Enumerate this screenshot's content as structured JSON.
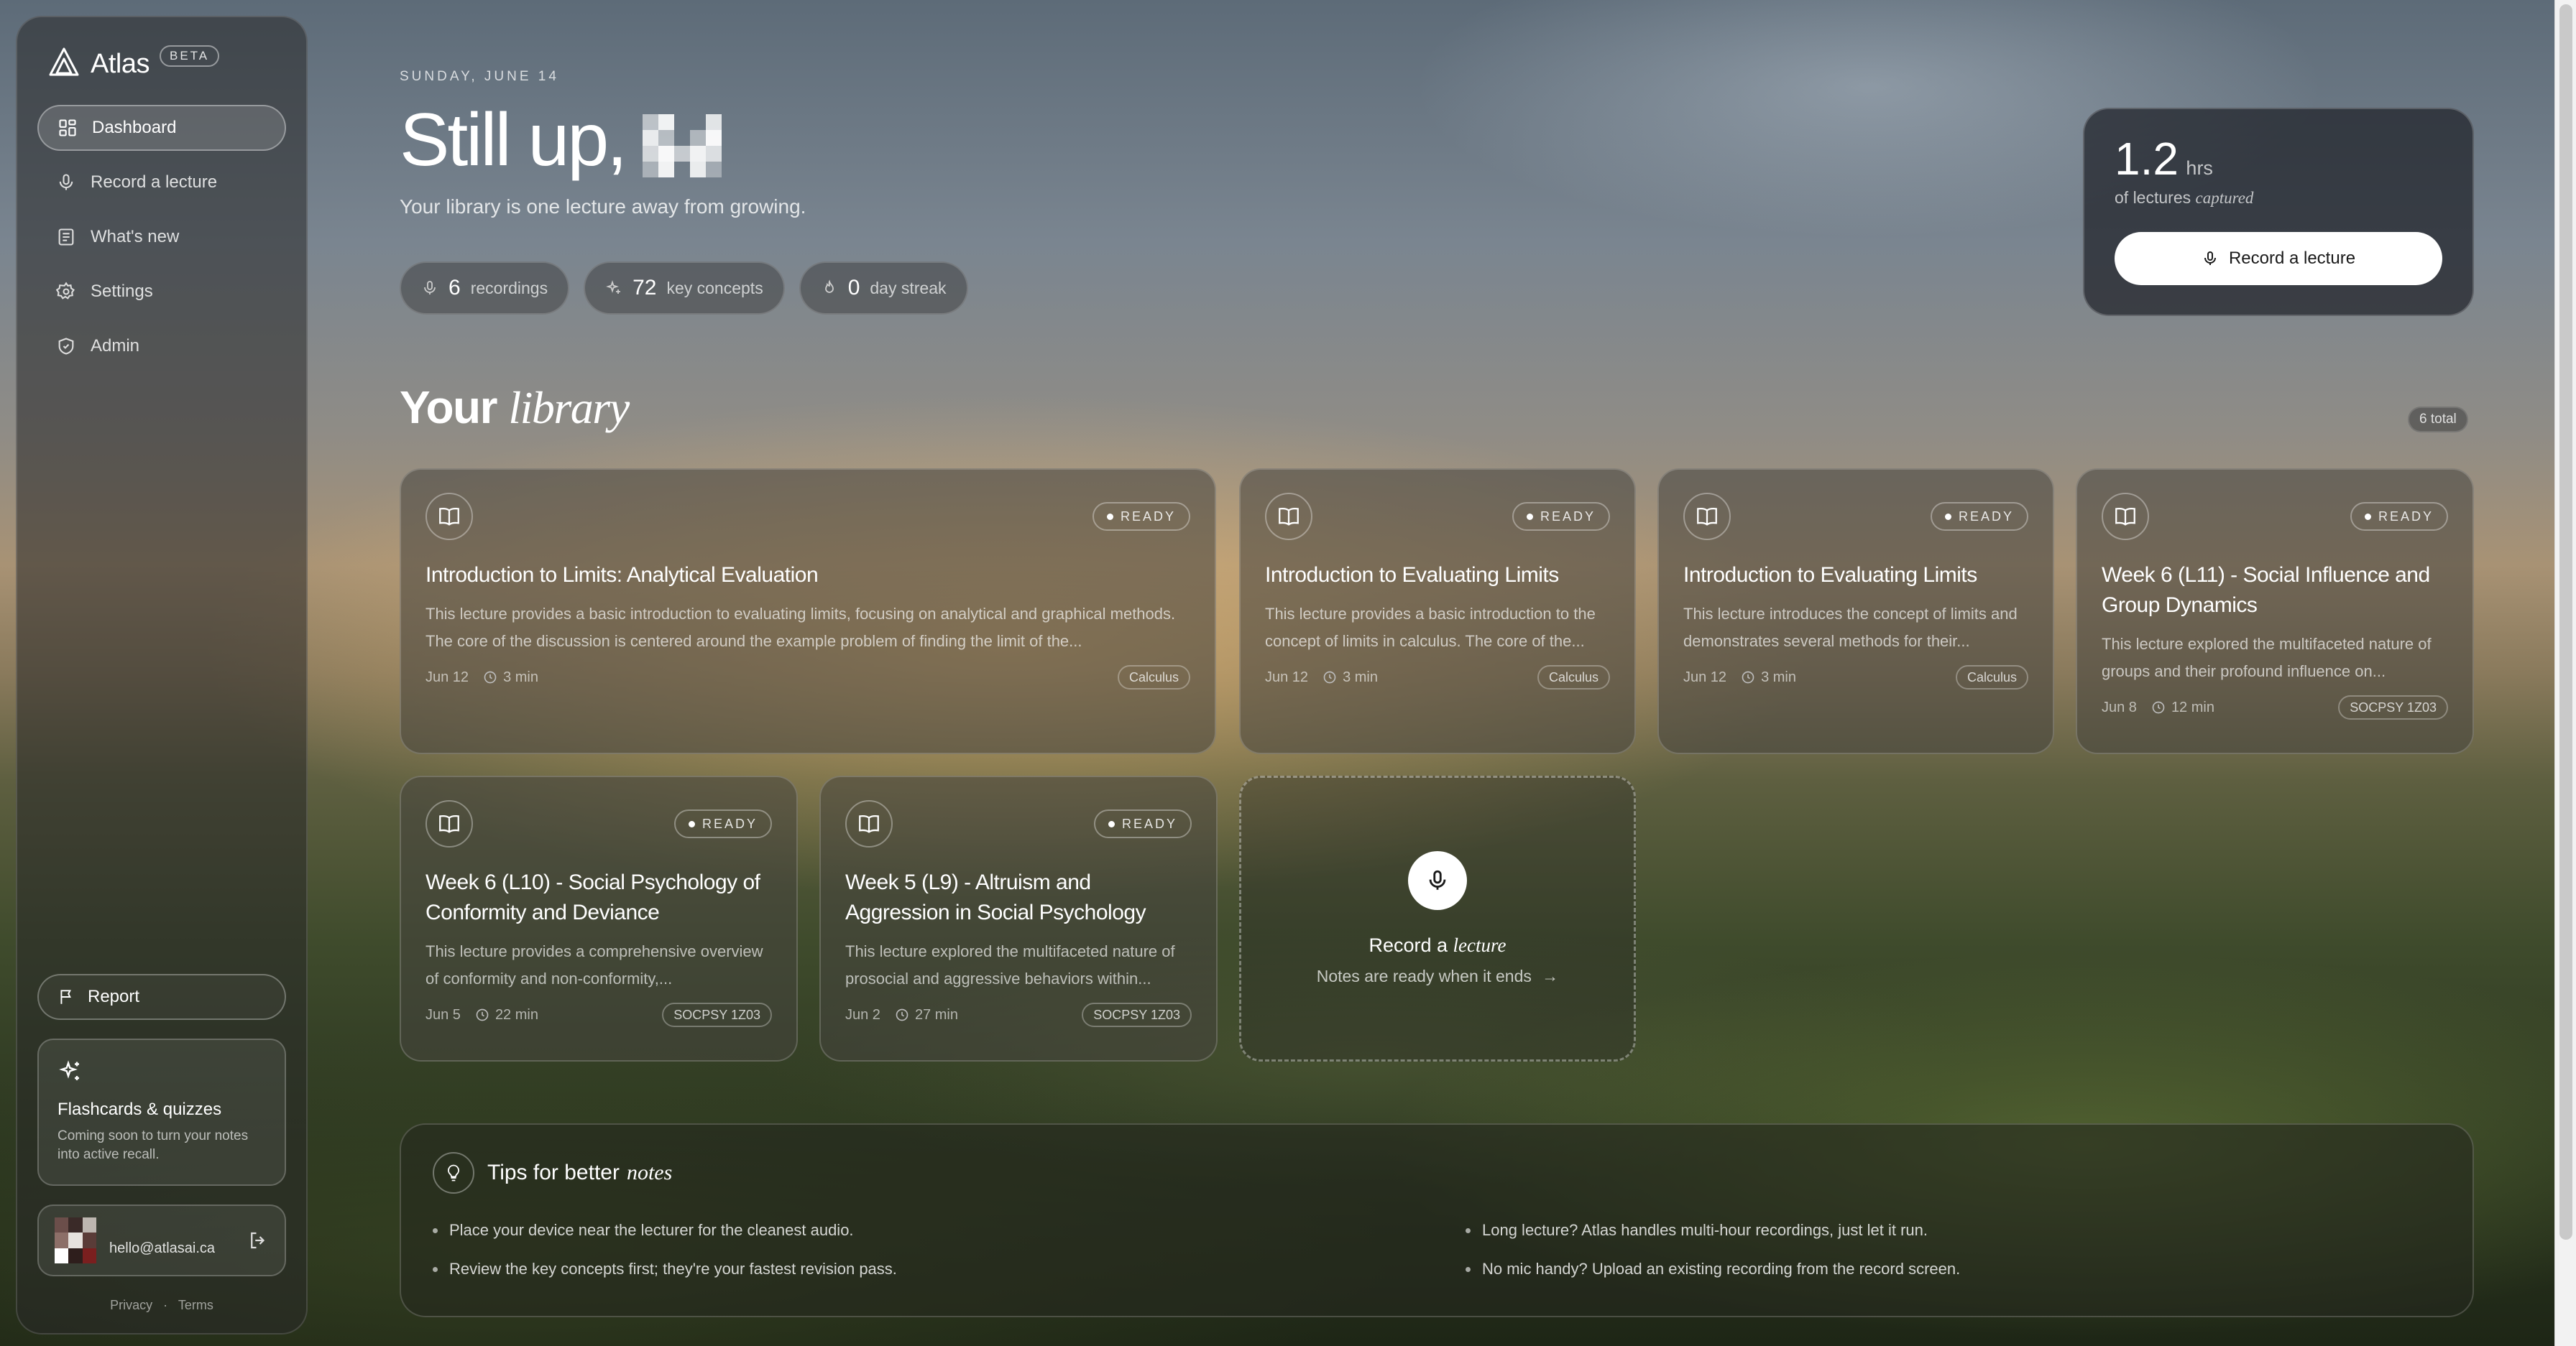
{
  "brand": {
    "name": "Atlas",
    "badge": "BETA"
  },
  "nav": [
    {
      "label": "Dashboard",
      "icon": "grid-icon",
      "active": true
    },
    {
      "label": "Record a lecture",
      "icon": "mic-icon"
    },
    {
      "label": "What's new",
      "icon": "news-icon"
    },
    {
      "label": "Settings",
      "icon": "gear-icon"
    },
    {
      "label": "Admin",
      "icon": "shield-icon"
    }
  ],
  "sidebar": {
    "report_label": "Report",
    "promo_title": "Flashcards & quizzes",
    "promo_text": "Coming soon to turn your notes into active recall.",
    "user_email": "hello@atlasai.ca",
    "privacy": "Privacy",
    "separator": "·",
    "terms": "Terms"
  },
  "header": {
    "date": "SUNDAY, JUNE 14",
    "greeting": "Still up,",
    "subtitle": "Your library is one lecture away from growing."
  },
  "stats": [
    {
      "value": "6",
      "label": "recordings",
      "icon": "mic-icon"
    },
    {
      "value": "72",
      "label": "key concepts",
      "icon": "sparkle-icon"
    },
    {
      "value": "0",
      "label": "day streak",
      "icon": "flame-icon"
    }
  ],
  "capture": {
    "value": "1.2",
    "unit": "hrs",
    "label_prefix": "of lectures",
    "label_em": "captured",
    "button": "Record a lecture"
  },
  "library": {
    "title_plain": "Your",
    "title_em": "library",
    "total": "6 total",
    "status": "READY",
    "cards": [
      {
        "title": "Introduction to Limits: Analytical Evaluation",
        "desc": "This lecture provides a basic introduction to evaluating limits, focusing on analytical and graphical methods. The core of the discussion is centered around the example problem of finding the limit of the...",
        "date": "Jun 12",
        "duration": "3 min",
        "tag": "Calculus"
      },
      {
        "title": "Introduction to Evaluating Limits",
        "desc": "This lecture provides a basic introduction to the concept of limits in calculus. The core of the...",
        "date": "Jun 12",
        "duration": "3 min",
        "tag": "Calculus"
      },
      {
        "title": "Introduction to Evaluating Limits",
        "desc": "This lecture introduces the concept of limits and demonstrates several methods for their...",
        "date": "Jun 12",
        "duration": "3 min",
        "tag": "Calculus"
      },
      {
        "title": "Week 6 (L11) - Social Influence and Group Dynamics",
        "desc": "This lecture explored the multifaceted nature of groups and their profound influence on...",
        "date": "Jun 8",
        "duration": "12 min",
        "tag": "SOCPSY 1Z03"
      },
      {
        "title": "Week 6 (L10) - Social Psychology of Conformity and Deviance",
        "desc": "This lecture provides a comprehensive overview of conformity and non-conformity,...",
        "date": "Jun 5",
        "duration": "22 min",
        "tag": "SOCPSY 1Z03"
      },
      {
        "title": "Week 5 (L9) - Altruism and Aggression in Social Psychology",
        "desc": "This lecture explored the multifaceted nature of prosocial and aggressive behaviors within...",
        "date": "Jun 2",
        "duration": "27 min",
        "tag": "SOCPSY 1Z03"
      }
    ]
  },
  "record_card": {
    "title_plain": "Record a",
    "title_em": "lecture",
    "sub": "Notes are ready when it ends",
    "arrow": "→"
  },
  "tips": {
    "title_plain": "Tips for better",
    "title_em": "notes",
    "items": [
      "Place your device near the lecturer for the cleanest audio.",
      "Long lecture? Atlas handles multi-hour recordings, just let it run.",
      "Review the key concepts first; they're your fastest revision pass.",
      "No mic handy? Upload an existing recording from the record screen."
    ]
  },
  "colors": {
    "accent": "#ffffff",
    "panel": "#2a2a2a"
  }
}
